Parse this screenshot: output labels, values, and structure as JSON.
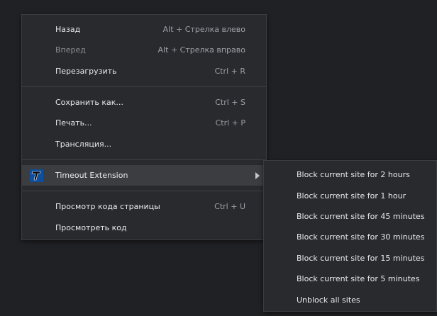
{
  "context_menu": {
    "back": {
      "label": "Назад",
      "shortcut": "Alt + Стрелка влево"
    },
    "forward": {
      "label": "Вперед",
      "shortcut": "Alt + Стрелка вправо"
    },
    "reload": {
      "label": "Перезагрузить",
      "shortcut": "Ctrl + R"
    },
    "save_as": {
      "label": "Сохранить как...",
      "shortcut": "Ctrl + S"
    },
    "print": {
      "label": "Печать...",
      "shortcut": "Ctrl + P"
    },
    "cast": {
      "label": "Трансляция..."
    },
    "extension": {
      "label": "Timeout Extension",
      "icon": "timeout-extension-icon"
    },
    "view_source": {
      "label": "Просмотр кода страницы",
      "shortcut": "Ctrl + U"
    },
    "inspect": {
      "label": "Просмотреть код"
    }
  },
  "submenu": {
    "items": [
      "Block current site for 2 hours",
      "Block current site for 1 hour",
      "Block current site for 45 minutes",
      "Block current site for 30 minutes",
      "Block current site for 15 minutes",
      "Block current site for 5 minutes",
      "Unblock all sites"
    ]
  },
  "colors": {
    "menu_bg": "#292a2d",
    "page_bg": "#202124",
    "highlight": "#3c3d41",
    "text": "#e8eaed",
    "shortcut_text": "#9aa0a6",
    "icon_blue": "#1a6fc9"
  }
}
